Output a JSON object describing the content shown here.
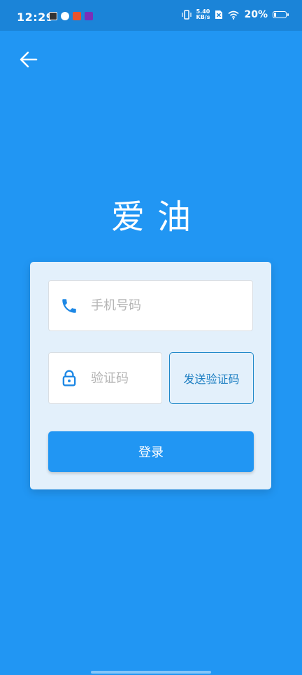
{
  "status_bar": {
    "time": "12:29",
    "net_speed_value": "5.40",
    "net_speed_unit": "KB/s",
    "battery_percent": "20%",
    "battery_level": 0.2
  },
  "header": {
    "back_icon": "arrow-left-icon"
  },
  "app": {
    "title": "爱油"
  },
  "login_form": {
    "phone_placeholder": "手机号码",
    "phone_value": "",
    "code_placeholder": "验证码",
    "code_value": "",
    "send_code_label": "发送验证码",
    "login_label": "登录"
  },
  "colors": {
    "background": "#2196F3",
    "card": "#E3F0FB",
    "accent": "#1E7FC2"
  },
  "icons": {
    "phone": "phone-icon",
    "lock": "lock-icon"
  }
}
